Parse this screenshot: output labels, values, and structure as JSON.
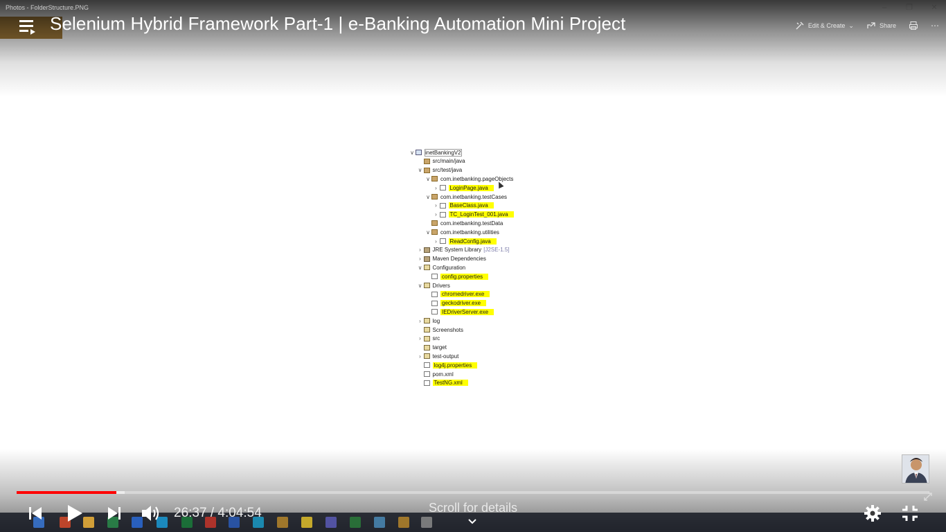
{
  "photos_app": {
    "window_title": "Photos - FolderStructure.PNG",
    "tab_label": "photos",
    "toolbar": {
      "edit_create": "Edit & Create",
      "share": "Share"
    }
  },
  "video": {
    "title": "Selenium Hybrid Framework Part-1 | e-Banking Automation Mini Project",
    "current_time": "26:37",
    "duration": "4:04:54",
    "time_display": "26:37 / 4:04:54",
    "progress_played": 0.109,
    "progress_loaded": 0.118,
    "scroll_hint": "Scroll for details"
  },
  "project_tree": [
    {
      "label": "inetBankingV2",
      "indent": 0,
      "chev": "open",
      "icon": "project",
      "highlight": false
    },
    {
      "label": "src/main/java",
      "indent": 1,
      "chev": "",
      "icon": "pkg",
      "highlight": false
    },
    {
      "label": "src/test/java",
      "indent": 1,
      "chev": "open",
      "icon": "pkg",
      "highlight": false
    },
    {
      "label": "com.inetbanking.pageObjects",
      "indent": 2,
      "chev": "open",
      "icon": "pkg",
      "highlight": false
    },
    {
      "label": "LoginPage.java",
      "indent": 3,
      "chev": "closed",
      "icon": "file",
      "highlight": true
    },
    {
      "label": "com.inetbanking.testCases",
      "indent": 2,
      "chev": "open",
      "icon": "pkg",
      "highlight": false
    },
    {
      "label": "BaseClass.java",
      "indent": 3,
      "chev": "closed",
      "icon": "file",
      "highlight": true
    },
    {
      "label": "TC_LoginTest_001.java",
      "indent": 3,
      "chev": "closed",
      "icon": "file",
      "highlight": true
    },
    {
      "label": "com.inetbanking.testData",
      "indent": 2,
      "chev": "",
      "icon": "pkg",
      "highlight": false
    },
    {
      "label": "com.inetbanking.utilities",
      "indent": 2,
      "chev": "open",
      "icon": "pkg",
      "highlight": false
    },
    {
      "label": "ReadConfig.java",
      "indent": 3,
      "chev": "closed",
      "icon": "file",
      "highlight": true
    },
    {
      "label": "JRE System Library",
      "suffix": "[J2SE-1.5]",
      "indent": 1,
      "chev": "closed",
      "icon": "lib",
      "highlight": false
    },
    {
      "label": "Maven Dependencies",
      "indent": 1,
      "chev": "closed",
      "icon": "lib",
      "highlight": false
    },
    {
      "label": "Configuration",
      "indent": 1,
      "chev": "open",
      "icon": "folder",
      "highlight": false
    },
    {
      "label": "config.properties",
      "indent": 2,
      "chev": "",
      "icon": "file",
      "highlight": true
    },
    {
      "label": "Drivers",
      "indent": 1,
      "chev": "open",
      "icon": "folder",
      "highlight": false
    },
    {
      "label": "chromedriver.exe",
      "indent": 2,
      "chev": "",
      "icon": "file",
      "highlight": true
    },
    {
      "label": "geckodriver.exe",
      "indent": 2,
      "chev": "",
      "icon": "file",
      "highlight": true
    },
    {
      "label": "IEDriverServer.exe",
      "indent": 2,
      "chev": "",
      "icon": "file",
      "highlight": true
    },
    {
      "label": "log",
      "indent": 1,
      "chev": "closed",
      "icon": "folder",
      "highlight": false
    },
    {
      "label": "Screenshots",
      "indent": 1,
      "chev": "",
      "icon": "folder",
      "highlight": false
    },
    {
      "label": "src",
      "indent": 1,
      "chev": "closed",
      "icon": "folder",
      "highlight": false
    },
    {
      "label": "target",
      "indent": 1,
      "chev": "",
      "icon": "folder",
      "highlight": false
    },
    {
      "label": "test-output",
      "indent": 1,
      "chev": "closed",
      "icon": "folder",
      "highlight": false
    },
    {
      "label": "log4j.properties",
      "indent": 1,
      "chev": "",
      "icon": "file",
      "highlight": true
    },
    {
      "label": "pom.xml",
      "indent": 1,
      "chev": "",
      "icon": "file",
      "highlight": false
    },
    {
      "label": "TestNG.xml",
      "indent": 1,
      "chev": "",
      "icon": "file",
      "highlight": true
    }
  ],
  "colors": {
    "progress": "#ff0000",
    "highlight": "#ffff00",
    "photos_tab": "#9a6a1a"
  }
}
